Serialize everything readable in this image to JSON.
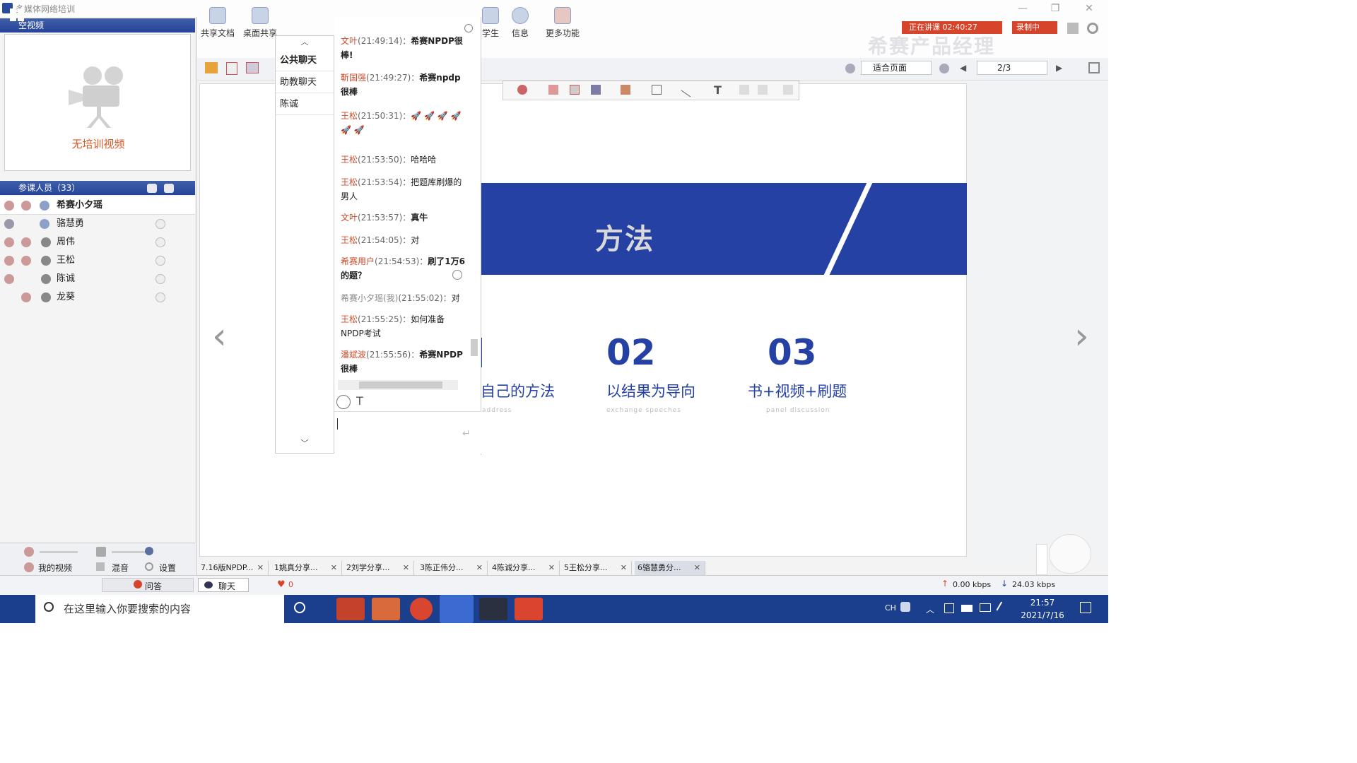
{
  "window": {
    "title": "多媒体网络培训"
  },
  "left": {
    "video_header": "空视频",
    "no_video": "无培训视频",
    "participants_header": "参课人员（33）",
    "participants": [
      {
        "name": "希赛小夕瑶"
      },
      {
        "name": "骆慧勇"
      },
      {
        "name": "周伟"
      },
      {
        "name": "王松"
      },
      {
        "name": "陈诚"
      },
      {
        "name": "龙葵"
      }
    ],
    "bottom": {
      "my_video": "我的视频",
      "mix": "混音",
      "settings": "设置"
    }
  },
  "toolbar": {
    "share_doc": "共享文档",
    "desktop_share": "桌面共享",
    "students": "学生",
    "info": "信息",
    "more": "更多功能",
    "teaching_status": "正在讲课 02:40:27",
    "recording": "录制中",
    "watermark": "希赛产品经理"
  },
  "toolbar2": {
    "fit": "适合页面",
    "page": "2/3"
  },
  "chat_tabs": [
    "公共聊天",
    "助教聊天",
    "陈诚"
  ],
  "chat_messages": [
    {
      "who": "文叶",
      "time": "(21:49:14)：",
      "text": "希赛NPDP很棒!",
      "bold": true
    },
    {
      "who": "靳国强",
      "time": "(21:49:27)：",
      "text": "希赛npdp很棒",
      "bold": true
    },
    {
      "who": "王松",
      "time": "(21:50:31)：",
      "text": "🚀 🚀 🚀 🚀 🚀 🚀",
      "bold": false
    },
    {
      "who": "王松",
      "time": "(21:53:50)：",
      "text": "哈哈哈",
      "bold": false
    },
    {
      "who": "王松",
      "time": "(21:53:54)：",
      "text": "把题库刷爆的男人",
      "bold": false
    },
    {
      "who": "文叶",
      "time": "(21:53:57)：",
      "text": "真牛",
      "bold": true
    },
    {
      "who": "王松",
      "time": "(21:54:05)：",
      "text": "对",
      "bold": false
    },
    {
      "who": "希赛用户",
      "time": "(21:54:53)：",
      "text": "刷了1万6的题？",
      "bold": true
    },
    {
      "who": "希赛小夕瑶(我)",
      "time": "(21:55:02)：",
      "text": "对",
      "bold": false
    },
    {
      "who": "王松",
      "time": "(21:55:25)：",
      "text": "如何准备NPDP考试",
      "bold": false
    },
    {
      "who": "潘斌波",
      "time": "(21:55:56)：",
      "text": "希赛NPDP很棒",
      "bold": true
    }
  ],
  "slide": {
    "title": "方法",
    "items": [
      {
        "num": "",
        "caption": "自己的方法",
        "sub": "address"
      },
      {
        "num": "02",
        "caption": "以结果为导向",
        "sub": "exchange speeches"
      },
      {
        "num": "03",
        "caption": "书+视频+刷题",
        "sub": "panel discussion"
      }
    ]
  },
  "doc_tabs": [
    "7.16版NPDP...",
    "1姚真分享...",
    "2刘学分享...",
    "3陈正伟分...",
    "4陈诚分享...",
    "5王松分享...",
    "6骆慧勇分..."
  ],
  "status": {
    "qa": "问答",
    "chat": "聊天",
    "likes": "0",
    "upload": "0.00 kbps",
    "download": "24.03 kbps"
  },
  "taskbar": {
    "search_placeholder": "在这里输入你要搜索的内容",
    "time": "21:57",
    "date": "2021/7/16",
    "lang": "CH"
  },
  "colors": {
    "slide_blue": "#2541a3",
    "chat_name": "#d04a2a",
    "taskbar": "#1b3f8c"
  }
}
